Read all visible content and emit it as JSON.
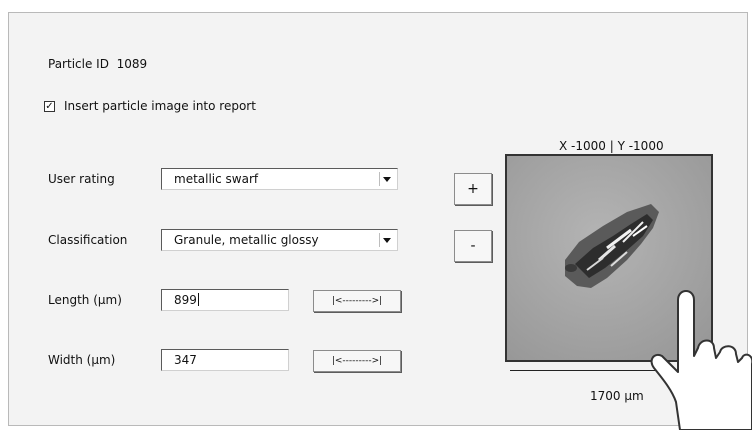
{
  "particle": {
    "label": "Particle ID",
    "id": "1089"
  },
  "insert_image": {
    "label": "Insert particle image into report",
    "checked": true,
    "check_glyph": "✓"
  },
  "fields": {
    "user_rating": {
      "label": "User rating",
      "value": "metallic swarf"
    },
    "classification": {
      "label": "Classification",
      "value": "Granule, metallic glossy"
    },
    "length": {
      "label": "Length (µm)",
      "value": "899",
      "button": "|<--------->|"
    },
    "width": {
      "label": "Width (µm)",
      "value": "347",
      "button": "|<--------->|"
    }
  },
  "zoom": {
    "plus": "+",
    "minus": "-"
  },
  "viewer": {
    "coordinates": "X -1000 | Y -1000",
    "scale": "1700 µm"
  }
}
